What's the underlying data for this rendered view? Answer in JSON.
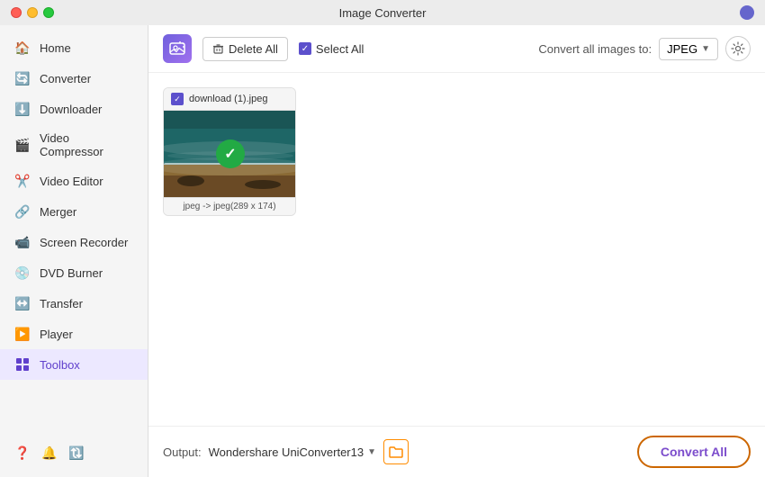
{
  "window": {
    "title": "Image Converter"
  },
  "toolbar": {
    "delete_all_label": "Delete All",
    "select_all_label": "Select All",
    "convert_label": "Convert all images to:",
    "format": "JPEG",
    "logo_icon": "image-add-icon"
  },
  "sidebar": {
    "items": [
      {
        "id": "home",
        "label": "Home",
        "icon": "🏠"
      },
      {
        "id": "converter",
        "label": "Converter",
        "icon": "🔄"
      },
      {
        "id": "downloader",
        "label": "Downloader",
        "icon": "⬇️"
      },
      {
        "id": "video-compressor",
        "label": "Video Compressor",
        "icon": "🎬"
      },
      {
        "id": "video-editor",
        "label": "Video Editor",
        "icon": "✂️"
      },
      {
        "id": "merger",
        "label": "Merger",
        "icon": "🔗"
      },
      {
        "id": "screen-recorder",
        "label": "Screen Recorder",
        "icon": "📹"
      },
      {
        "id": "dvd-burner",
        "label": "DVD Burner",
        "icon": "💿"
      },
      {
        "id": "transfer",
        "label": "Transfer",
        "icon": "↔️"
      },
      {
        "id": "player",
        "label": "Player",
        "icon": "▶️"
      },
      {
        "id": "toolbox",
        "label": "Toolbox",
        "icon": "⚙️",
        "active": true
      }
    ],
    "bottom": [
      {
        "id": "help",
        "icon": "❓"
      },
      {
        "id": "notifications",
        "icon": "🔔"
      },
      {
        "id": "activity",
        "icon": "🔃"
      }
    ]
  },
  "files": [
    {
      "name": "download (1).jpeg",
      "info": "jpeg -> jpeg(289 x 174)",
      "checked": true
    }
  ],
  "bottom": {
    "output_label": "Output:",
    "output_path": "Wondershare UniConverter13",
    "convert_btn_label": "Convert All"
  }
}
